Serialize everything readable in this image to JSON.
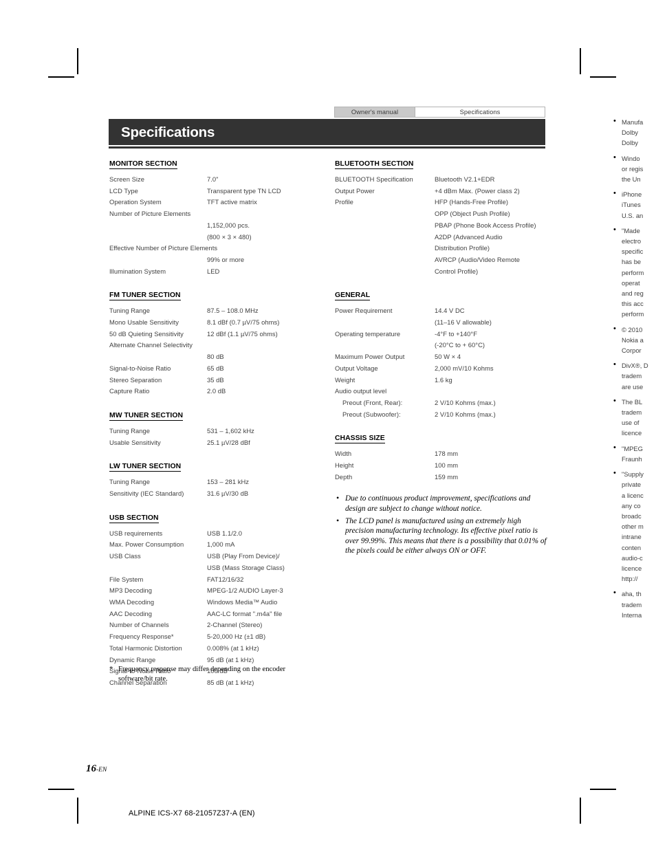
{
  "header": {
    "tab_inactive": "Owner's manual",
    "tab_active": "Specifications",
    "title": "Specifications"
  },
  "colors": {
    "banner_bg": "#333333",
    "tab_inactive_bg": "#c9c9c9",
    "text": "#3f3f3f"
  },
  "left_column": [
    {
      "heading": "MONITOR SECTION",
      "rows": [
        {
          "label": "Screen Size",
          "value": "7.0\""
        },
        {
          "label": "LCD Type",
          "value": "Transparent type TN LCD"
        },
        {
          "label": "Operation System",
          "value": "TFT active matrix"
        },
        {
          "label": "Number of Picture Elements",
          "value": "",
          "wide": true
        },
        {
          "label": "",
          "value": "1,152,000 pcs.",
          "valonly": true
        },
        {
          "label": "",
          "value": "(800 × 3 × 480)",
          "valonly": true
        },
        {
          "label": "Effective Number of Picture Elements",
          "value": "",
          "wide": true
        },
        {
          "label": "",
          "value": "99% or more",
          "valonly": true
        },
        {
          "label": "Illumination System",
          "value": "LED"
        }
      ]
    },
    {
      "heading": "FM TUNER SECTION",
      "rows": [
        {
          "label": "Tuning Range",
          "value": "87.5 – 108.0 MHz"
        },
        {
          "label": "Mono Usable Sensitivity",
          "value": "8.1 dBf (0.7 µV/75 ohms)"
        },
        {
          "label": "50 dB Quieting Sensitivity",
          "value": "12 dBf (1.1 µV/75 ohms)"
        },
        {
          "label": "Alternate Channel Selectivity",
          "value": "",
          "wide": true
        },
        {
          "label": "",
          "value": "80 dB",
          "valonly": true
        },
        {
          "label": "Signal-to-Noise Ratio",
          "value": "65 dB"
        },
        {
          "label": "Stereo Separation",
          "value": "35 dB"
        },
        {
          "label": "Capture Ratio",
          "value": "2.0 dB"
        }
      ]
    },
    {
      "heading": "MW TUNER SECTION",
      "rows": [
        {
          "label": "Tuning Range",
          "value": "531 – 1,602 kHz"
        },
        {
          "label": "Usable Sensitivity",
          "value": "25.1 µV/28 dBf"
        }
      ]
    },
    {
      "heading": "LW TUNER SECTION",
      "rows": [
        {
          "label": "Tuning Range",
          "value": "153 – 281 kHz"
        },
        {
          "label": "Sensitivity (IEC Standard)",
          "value": "31.6 µV/30 dB"
        }
      ]
    },
    {
      "heading": "USB SECTION",
      "rows": [
        {
          "label": "USB requirements",
          "value": "USB 1.1/2.0"
        },
        {
          "label": "Max. Power Consumption",
          "value": "1,000 mA"
        },
        {
          "label": "USB Class",
          "value": "USB (Play From Device)/"
        },
        {
          "label": "",
          "value": "USB (Mass Storage Class)",
          "valonly": true
        },
        {
          "label": "File System",
          "value": "FAT12/16/32"
        },
        {
          "label": "MP3 Decoding",
          "value": "MPEG-1/2 AUDIO Layer-3"
        },
        {
          "label": "WMA Decoding",
          "value": "Windows Media™ Audio"
        },
        {
          "label": "AAC Decoding",
          "value": "AAC-LC format \".m4a\" file"
        },
        {
          "label": "Number of Channels",
          "value": "2-Channel (Stereo)"
        },
        {
          "label": "Frequency Response*",
          "value": "5-20,000 Hz (±1 dB)"
        },
        {
          "label": "Total Harmonic Distortion",
          "value": "0.008% (at 1 kHz)"
        },
        {
          "label": "Dynamic Range",
          "value": "95 dB (at 1 kHz)"
        },
        {
          "label": "Signal-to-Noise Ratio",
          "value": "100 dB"
        },
        {
          "label": "Channel Separation",
          "value": "85 dB (at 1 kHz)"
        }
      ]
    }
  ],
  "mid_column": [
    {
      "heading": "BLUETOOTH SECTION",
      "rows": [
        {
          "label": "BLUETOOTH Specification",
          "value": "Bluetooth V2.1+EDR"
        },
        {
          "label": "Output Power",
          "value": "+4 dBm Max. (Power class 2)"
        },
        {
          "label": "Profile",
          "value": "HFP (Hands-Free Profile)"
        },
        {
          "label": "",
          "value": "OPP (Object Push Profile)",
          "valonly": true
        },
        {
          "label": "",
          "value": "PBAP (Phone Book Access Profile)",
          "valonly": true
        },
        {
          "label": "",
          "value": "A2DP (Advanced Audio",
          "valonly": true
        },
        {
          "label": "",
          "value": "Distribution Profile)",
          "valonly": true
        },
        {
          "label": "",
          "value": "AVRCP (Audio/Video Remote",
          "valonly": true
        },
        {
          "label": "",
          "value": "Control Profile)",
          "valonly": true
        }
      ]
    },
    {
      "heading": "GENERAL",
      "rows": [
        {
          "label": "Power Requirement",
          "value": "14.4 V DC"
        },
        {
          "label": "",
          "value": "(11–16 V allowable)",
          "valonly": true
        },
        {
          "label": "Operating temperature",
          "value": "-4°F to +140°F"
        },
        {
          "label": "",
          "value": "(-20°C to + 60°C)",
          "valonly": true
        },
        {
          "label": "Maximum Power Output",
          "value": "50 W × 4"
        },
        {
          "label": "Output Voltage",
          "value": "2,000 mV/10 Kohms"
        },
        {
          "label": "Weight",
          "value": "1.6 kg"
        },
        {
          "label": "Audio output level",
          "value": "",
          "wide": true
        },
        {
          "label": "Preout (Front, Rear):",
          "value": "2 V/10 Kohms (max.)",
          "indent": true
        },
        {
          "label": "Preout (Subwoofer):",
          "value": "2 V/10 Kohms (max.)",
          "indent": true
        }
      ]
    },
    {
      "heading": "CHASSIS SIZE",
      "rows": [
        {
          "label": "Width",
          "value": "178 mm"
        },
        {
          "label": "Height",
          "value": "100 mm"
        },
        {
          "label": "Depth",
          "value": "159 mm"
        }
      ]
    }
  ],
  "notes": [
    "Due to continuous product improvement, specifications and design are subject to change without notice.",
    "The LCD panel is manufactured using an extremely high precision manufacturing technology. Its effective pixel ratio is over 99.99%. This means that there is a possibility that 0.01% of the pixels could be either always ON or OFF."
  ],
  "footnote": {
    "marker": "*",
    "text": "Frequency response may differ depending on the encoder software/bit rate."
  },
  "right_column_clipped": [
    "Manufa\nDolby \nDolby",
    "Windo\nor regis\nthe Un",
    "iPhone\niTunes\nU.S. an",
    "\"Made\nelectro\nspecific\nhas be\nperform\noperat\nand reg\nthis acc\nperform",
    "© 2010\nNokia a\nCorpor",
    "DivX®, D\ntradem\nare use",
    "The BL\ntradem\nuse of \nlicence",
    "\"MPEG\nFraunh",
    "\"Supply\nprivate\na licenc\nany co\nbroadc\nother m\nintrane\nconten\naudio-c\nlicence\nhttp://",
    "aha, th\ntradem\nInterna"
  ],
  "footer": {
    "page_number": "16",
    "page_suffix": "-EN",
    "document_id": "ALPINE ICS-X7 68-21057Z37-A (EN)"
  }
}
